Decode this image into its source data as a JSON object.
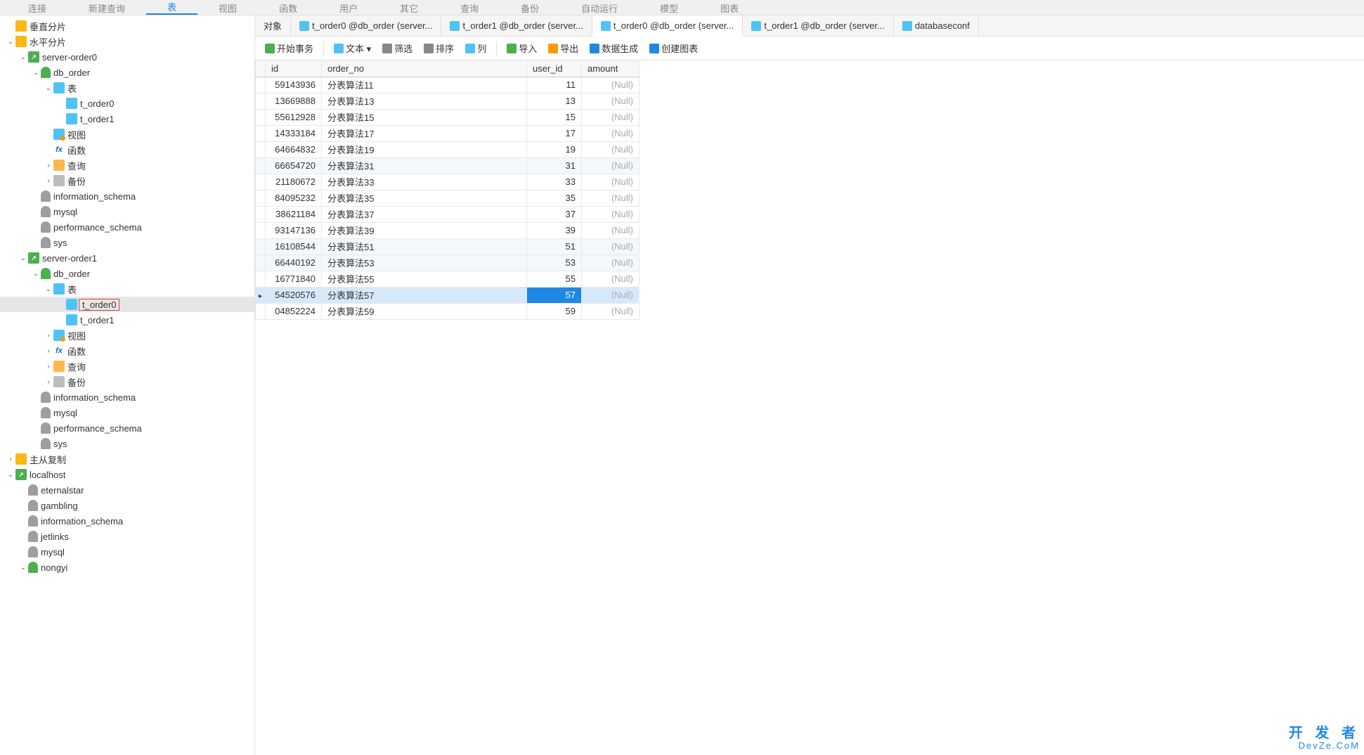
{
  "menu": [
    "连接",
    "新建查询",
    "表",
    "视图",
    "函数",
    "用户",
    "其它",
    "查询",
    "备份",
    "自动运行",
    "模型",
    "图表"
  ],
  "tree": [
    {
      "d": 0,
      "caret": "blank",
      "ico": "folder",
      "label": "垂直分片"
    },
    {
      "d": 0,
      "caret": "down",
      "ico": "folder",
      "label": "水平分片"
    },
    {
      "d": 1,
      "caret": "down",
      "ico": "conn",
      "label": "server-order0"
    },
    {
      "d": 2,
      "caret": "down",
      "ico": "db",
      "label": "db_order"
    },
    {
      "d": 3,
      "caret": "down",
      "ico": "tablenode",
      "label": "表"
    },
    {
      "d": 4,
      "caret": "blank",
      "ico": "table",
      "label": "t_order0"
    },
    {
      "d": 4,
      "caret": "blank",
      "ico": "table",
      "label": "t_order1"
    },
    {
      "d": 3,
      "caret": "blank",
      "ico": "view",
      "label": "视图"
    },
    {
      "d": 3,
      "caret": "blank",
      "ico": "fx",
      "label": "函数"
    },
    {
      "d": 3,
      "caret": "right",
      "ico": "query",
      "label": "查询"
    },
    {
      "d": 3,
      "caret": "right",
      "ico": "backup",
      "label": "备份"
    },
    {
      "d": 2,
      "caret": "blank",
      "ico": "db-gray",
      "label": "information_schema"
    },
    {
      "d": 2,
      "caret": "blank",
      "ico": "db-gray",
      "label": "mysql"
    },
    {
      "d": 2,
      "caret": "blank",
      "ico": "db-gray",
      "label": "performance_schema"
    },
    {
      "d": 2,
      "caret": "blank",
      "ico": "db-gray",
      "label": "sys"
    },
    {
      "d": 1,
      "caret": "down",
      "ico": "conn",
      "label": "server-order1"
    },
    {
      "d": 2,
      "caret": "down",
      "ico": "db",
      "label": "db_order"
    },
    {
      "d": 3,
      "caret": "down",
      "ico": "tablenode",
      "label": "表"
    },
    {
      "d": 4,
      "caret": "blank",
      "ico": "table",
      "label": "t_order0",
      "selected": true,
      "hl": true
    },
    {
      "d": 4,
      "caret": "blank",
      "ico": "table",
      "label": "t_order1"
    },
    {
      "d": 3,
      "caret": "right",
      "ico": "view",
      "label": "视图"
    },
    {
      "d": 3,
      "caret": "right",
      "ico": "fx",
      "label": "函数"
    },
    {
      "d": 3,
      "caret": "right",
      "ico": "query",
      "label": "查询"
    },
    {
      "d": 3,
      "caret": "right",
      "ico": "backup",
      "label": "备份"
    },
    {
      "d": 2,
      "caret": "blank",
      "ico": "db-gray",
      "label": "information_schema"
    },
    {
      "d": 2,
      "caret": "blank",
      "ico": "db-gray",
      "label": "mysql"
    },
    {
      "d": 2,
      "caret": "blank",
      "ico": "db-gray",
      "label": "performance_schema"
    },
    {
      "d": 2,
      "caret": "blank",
      "ico": "db-gray",
      "label": "sys"
    },
    {
      "d": 0,
      "caret": "right",
      "ico": "folder",
      "label": "主从复制"
    },
    {
      "d": 0,
      "caret": "down",
      "ico": "conn",
      "label": "localhost"
    },
    {
      "d": 1,
      "caret": "blank",
      "ico": "db-gray",
      "label": "eternalstar"
    },
    {
      "d": 1,
      "caret": "blank",
      "ico": "db-gray",
      "label": "gambling"
    },
    {
      "d": 1,
      "caret": "blank",
      "ico": "db-gray",
      "label": "information_schema"
    },
    {
      "d": 1,
      "caret": "blank",
      "ico": "db-gray",
      "label": "jetlinks"
    },
    {
      "d": 1,
      "caret": "blank",
      "ico": "db-gray",
      "label": "mysql"
    },
    {
      "d": 1,
      "caret": "down",
      "ico": "db",
      "label": "nongyi"
    }
  ],
  "tabs": [
    {
      "label": "对象",
      "icon": false
    },
    {
      "label": "t_order0 @db_order (server...",
      "icon": true
    },
    {
      "label": "t_order1 @db_order (server...",
      "icon": true
    },
    {
      "label": "t_order0 @db_order (server...",
      "icon": true,
      "active": true
    },
    {
      "label": "t_order1 @db_order (server...",
      "icon": true
    },
    {
      "label": "databaseconf",
      "icon": true
    }
  ],
  "toolbar": [
    {
      "label": "开始事务",
      "color": "#4caf50"
    },
    {
      "sep": true
    },
    {
      "label": "文本 ▾",
      "color": "#4fc3f7"
    },
    {
      "label": "筛选",
      "color": "#888"
    },
    {
      "label": "排序",
      "color": "#888"
    },
    {
      "label": "列",
      "color": "#4fc3f7"
    },
    {
      "sep": true
    },
    {
      "label": "导入",
      "color": "#4caf50"
    },
    {
      "label": "导出",
      "color": "#ff9800"
    },
    {
      "label": "数据生成",
      "color": "#1e88e5"
    },
    {
      "label": "创建图表",
      "color": "#1e88e5"
    }
  ],
  "columns": [
    "id",
    "order_no",
    "user_id",
    "amount"
  ],
  "colclass": [
    "col-id",
    "col-orderno",
    "col-userid",
    "col-amount"
  ],
  "rows": [
    {
      "id": "59143936",
      "order_no": "分表算法11",
      "user_id": "11",
      "amount": "(Null)"
    },
    {
      "id": "13669888",
      "order_no": "分表算法13",
      "user_id": "13",
      "amount": "(Null)"
    },
    {
      "id": "55612928",
      "order_no": "分表算法15",
      "user_id": "15",
      "amount": "(Null)"
    },
    {
      "id": "14333184",
      "order_no": "分表算法17",
      "user_id": "17",
      "amount": "(Null)"
    },
    {
      "id": "64664832",
      "order_no": "分表算法19",
      "user_id": "19",
      "amount": "(Null)"
    },
    {
      "id": "66654720",
      "order_no": "分表算法31",
      "user_id": "31",
      "amount": "(Null)",
      "zebra": true
    },
    {
      "id": "21180672",
      "order_no": "分表算法33",
      "user_id": "33",
      "amount": "(Null)"
    },
    {
      "id": "84095232",
      "order_no": "分表算法35",
      "user_id": "35",
      "amount": "(Null)"
    },
    {
      "id": "38621184",
      "order_no": "分表算法37",
      "user_id": "37",
      "amount": "(Null)"
    },
    {
      "id": "93147136",
      "order_no": "分表算法39",
      "user_id": "39",
      "amount": "(Null)"
    },
    {
      "id": "16108544",
      "order_no": "分表算法51",
      "user_id": "51",
      "amount": "(Null)",
      "zebra": true
    },
    {
      "id": "66440192",
      "order_no": "分表算法53",
      "user_id": "53",
      "amount": "(Null)",
      "zebra": true
    },
    {
      "id": "16771840",
      "order_no": "分表算法55",
      "user_id": "55",
      "amount": "(Null)"
    },
    {
      "id": "54520576",
      "order_no": "分表算法57",
      "user_id": "57",
      "amount": "(Null)",
      "sel": true
    },
    {
      "id": "04852224",
      "order_no": "分表算法59",
      "user_id": "59",
      "amount": "(Null)"
    }
  ],
  "watermark": {
    "line1": "开 发 者",
    "line2": "DevZe.CoM"
  }
}
